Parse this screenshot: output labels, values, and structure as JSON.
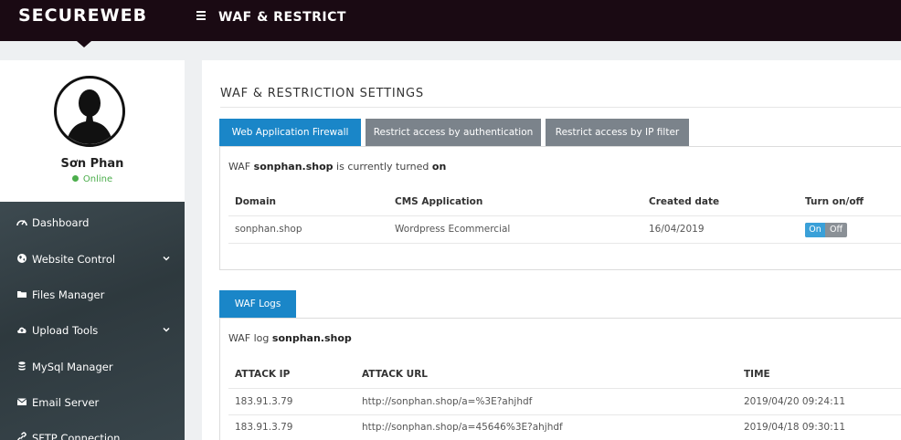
{
  "header": {
    "brand": "SECUREWEB",
    "page_title": "WAF & RESTRICT"
  },
  "profile": {
    "name": "Sơn Phan",
    "status": "Online"
  },
  "sidebar": {
    "items": [
      {
        "label": "Dashboard",
        "icon": "dashboard-icon"
      },
      {
        "label": "Website Control",
        "icon": "globe-icon",
        "expandable": true
      },
      {
        "label": "Files Manager",
        "icon": "folder-icon"
      },
      {
        "label": "Upload Tools",
        "icon": "cloud-upload-icon",
        "expandable": true
      },
      {
        "label": "MySql Manager",
        "icon": "database-icon"
      },
      {
        "label": "Email Server",
        "icon": "envelope-icon"
      },
      {
        "label": "SFTP Connection",
        "icon": "link-icon"
      }
    ]
  },
  "main": {
    "title": "WAF & RESTRICTION SETTINGS",
    "tabs": [
      {
        "label": "Web Application Firewall",
        "active": true
      },
      {
        "label": "Restrict access by authentication",
        "active": false
      },
      {
        "label": "Restrict access by IP filter",
        "active": false
      }
    ],
    "waf": {
      "status_prefix": "WAF",
      "domain": "sonphan.shop",
      "status_middle": "is currently turned",
      "status_value": "on",
      "columns": [
        "Domain",
        "CMS Application",
        "Created date",
        "Turn on/off"
      ],
      "rows": [
        {
          "domain": "sonphan.shop",
          "cms": "Wordpress Ecommercial",
          "created": "16/04/2019",
          "toggle_on": "On",
          "toggle_off": "Off"
        }
      ]
    },
    "logs": {
      "tab_label": "WAF Logs",
      "heading_prefix": "WAF log",
      "domain": "sonphan.shop",
      "columns": [
        "ATTACK IP",
        "ATTACK URL",
        "TIME"
      ],
      "rows": [
        {
          "ip": "183.91.3.79",
          "url": "http://sonphan.shop/a=%3E?ahjhdf",
          "time": "2019/04/20 09:24:11"
        },
        {
          "ip": "183.91.3.79",
          "url": "http://sonphan.shop/a=45646%3E?ahjhdf",
          "time": "2019/04/18 09:30:11"
        }
      ]
    }
  },
  "colors": {
    "topbar": "#1a0a13",
    "accent": "#1a86c8",
    "tab_inactive": "#7b838b",
    "online": "#4cae4c"
  }
}
